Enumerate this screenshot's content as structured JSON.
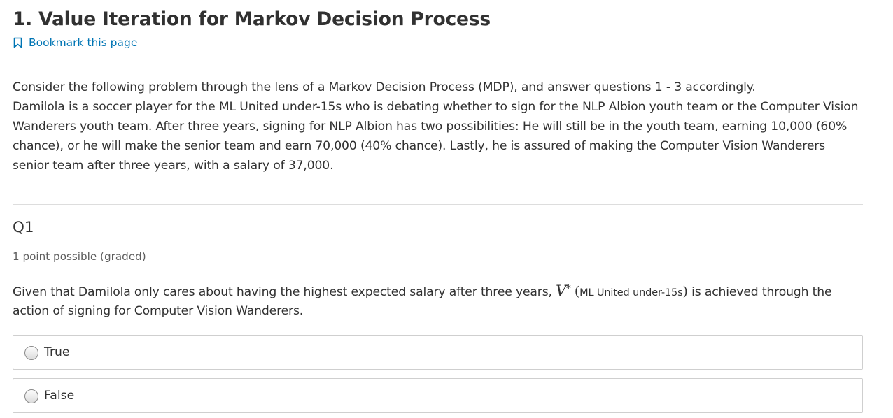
{
  "header": {
    "title": "1. Value Iteration for Markov Decision Process",
    "bookmark_label": "Bookmark this page",
    "bookmark_icon": "bookmark-icon",
    "link_color": "#0075b4"
  },
  "problem": {
    "intro": "Consider the following problem through the lens of a Markov Decision Process (MDP), and answer questions 1 - 3 accordingly.",
    "body": "Damilola is a soccer player for the ML United under-15s who is debating whether to sign for the NLP Albion youth team or the Computer Vision Wanderers youth team. After three years, signing for NLP Albion has two possibilities: He will still be in the youth team, earning 10,000 (60% chance), or he will make the senior team and earn 70,000 (40% chance). Lastly, he is assured of making the Computer Vision Wanderers senior team after three years, with a salary of 37,000."
  },
  "question": {
    "heading": "Q1",
    "points": "1 point possible (graded)",
    "text_before": "Given that Damilola only cares about having the highest expected salary after three years, ",
    "v_symbol": "V",
    "v_star": "*",
    "paren_open": "(",
    "state": "ML United under-15s",
    "paren_close": ")",
    "text_after": " is achieved through the action of signing for Computer Vision Wanderers.",
    "choices": [
      {
        "label": "True",
        "selected": false
      },
      {
        "label": "False",
        "selected": false
      }
    ]
  }
}
